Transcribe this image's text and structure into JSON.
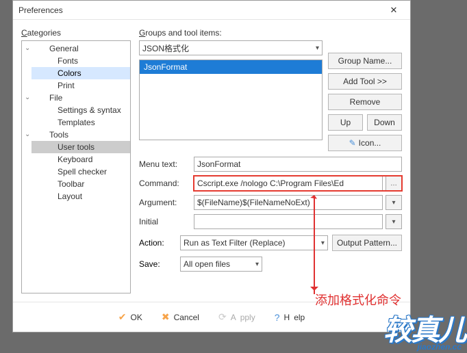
{
  "window": {
    "title": "Preferences",
    "close_glyph": "✕"
  },
  "categories": {
    "label_pre": "C",
    "label_post": "ategories",
    "branches": [
      {
        "label": "General",
        "children": [
          "Fonts",
          "Colors",
          "Print"
        ],
        "highlighted": "Colors"
      },
      {
        "label": "File",
        "children": [
          "Settings & syntax",
          "Templates"
        ]
      },
      {
        "label": "Tools",
        "children": [
          "User tools",
          "Keyboard",
          "Spell checker",
          "Toolbar",
          "Layout"
        ],
        "selected": "User tools"
      }
    ]
  },
  "groups": {
    "label_pre": "G",
    "label_post": "roups and tool items:",
    "combo_value": "JSON格式化",
    "list": [
      "JsonFormat"
    ],
    "buttons": {
      "group_name": "Group Name...",
      "add_tool_pre": "A",
      "add_tool_post": "dd Tool >>",
      "remove_pre": "R",
      "remove_post": "emove",
      "up": "Up",
      "down": "Down",
      "icon_pre": "I",
      "icon_post": "con..."
    }
  },
  "form": {
    "menu_text_lbl_pre": "Menu te",
    "menu_text_lbl_ul": "x",
    "menu_text_lbl_post": "t:",
    "menu_text_val": "JsonFormat",
    "command_lbl_pre": "C",
    "command_lbl_ul": "o",
    "command_lbl_post": "mmand:",
    "command_val": "Cscript.exe /nologo C:\\Program Files\\Ed",
    "argument_lbl_pre": "Argum",
    "argument_lbl_ul": "e",
    "argument_lbl_post": "nt:",
    "argument_val": "$(FileName)$(FileNameNoExt)",
    "initial_lbl_pre": "I",
    "initial_lbl_ul": "n",
    "initial_lbl_post": "itial",
    "initial_val": "",
    "action_lbl": "Action:",
    "action_val": "Run as Text Filter (Replace)",
    "output_btn": "Output Pattern...",
    "save_lbl": "Save:",
    "save_val": "All open files"
  },
  "buttons": {
    "ok": "OK",
    "cancel": "Cancel",
    "apply_pre": "A",
    "apply_post": "pply",
    "help_pre": "H",
    "help_post": "elp"
  },
  "annotation": "添加格式化命令",
  "watermark": {
    "cn": "较真儿",
    "py": "jiaozhen.cc"
  }
}
